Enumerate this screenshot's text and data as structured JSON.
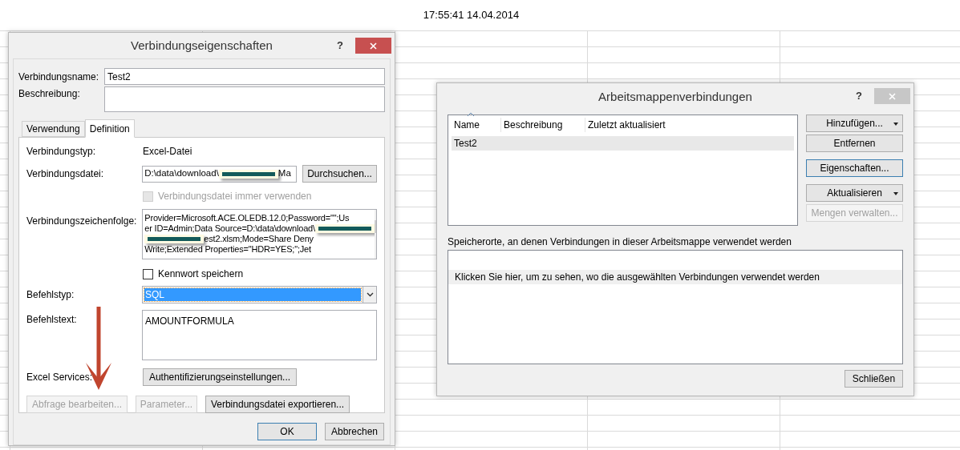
{
  "clock": "17:55:41 14.04.2014",
  "properties_dialog": {
    "title": "Verbindungseigenschaften",
    "help": "?",
    "name": {
      "label": "Verbindungsname:",
      "value": "Test2"
    },
    "description": {
      "label": "Beschreibung:"
    },
    "tabs": [
      {
        "label": "Verwendung",
        "selected": false
      },
      {
        "label": "Definition",
        "selected": true
      }
    ],
    "connection_type": {
      "label": "Verbindungstyp:",
      "value": "Excel-Datei"
    },
    "connection_file": {
      "label": "Verbindungsdatei:",
      "segments": [
        {
          "kind": "text",
          "text": "D:\\data\\download\\"
        },
        {
          "kind": "redacted"
        },
        {
          "kind": "text",
          "text": "Ma"
        }
      ],
      "button": "Durchsuchen..."
    },
    "always_use_file": {
      "label": "Verbindungsdatei immer verwenden",
      "checked": false,
      "disabled": true
    },
    "connection_string": {
      "label": "Verbindungszeichenfolge:",
      "lines": [
        [
          {
            "kind": "text",
            "text": "Provider=Microsoft.ACE.OLEDB.12.0;Password=\"\";Us"
          }
        ],
        [
          {
            "kind": "text",
            "text": "er ID=Admin;Data Source=D:\\data\\download\\"
          },
          {
            "kind": "redacted"
          }
        ],
        [
          {
            "kind": "redacted"
          },
          {
            "kind": "text",
            "text": "est2.xlsm;Mode=Share Deny"
          }
        ],
        [
          {
            "kind": "text",
            "text": "Write;Extended Properties=\"HDR=YES;\";Jet"
          }
        ]
      ]
    },
    "save_password": {
      "label": "Kennwort speichern",
      "checked": false,
      "disabled": false
    },
    "command_type": {
      "label": "Befehlstyp:",
      "value": "SQL",
      "highlighted": true
    },
    "command_text": {
      "label": "Befehlstext:",
      "value": "AMOUNTFORMULA"
    },
    "excel_services": {
      "label": "Excel Services:",
      "button": "Authentifizierungseinstellungen..."
    },
    "action_buttons": [
      {
        "label": "Abfrage bearbeiten...",
        "disabled": true
      },
      {
        "label": "Parameter...",
        "disabled": true
      },
      {
        "label": "Verbindungsdatei exportieren...",
        "disabled": false
      }
    ],
    "footer_buttons": [
      {
        "label": "OK",
        "default": true
      },
      {
        "label": "Abbrechen",
        "default": false
      }
    ]
  },
  "connections_dialog": {
    "title": "Arbeitsmappenverbindungen",
    "help": "?",
    "columns": [
      {
        "label": "Name",
        "sorted": true
      },
      {
        "label": "Beschreibung",
        "sorted": false
      },
      {
        "label": "Zuletzt aktualisiert",
        "sorted": false
      }
    ],
    "rows": [
      {
        "name": "Test2",
        "selected": true
      }
    ],
    "buttons": [
      {
        "label": "Hinzufügen...",
        "kind": "split",
        "focused": false,
        "disabled": false
      },
      {
        "label": "Entfernen",
        "kind": "plain",
        "focused": false,
        "disabled": false
      },
      {
        "label": "Eigenschaften...",
        "kind": "plain",
        "focused": true,
        "disabled": false
      },
      {
        "label": "Aktualisieren",
        "kind": "split",
        "focused": false,
        "disabled": false
      },
      {
        "label": "Mengen verwalten...",
        "kind": "plain",
        "focused": false,
        "disabled": true
      }
    ],
    "locations_label": "Speicherorte, an denen Verbindungen in dieser Arbeitsmappe verwendet werden",
    "locations_hint": {
      "text": "Klicken Sie hier, um zu sehen, wo die ausgewählten Verbindungen verwendet werden",
      "selected": true
    },
    "close_button": "Schließen"
  }
}
